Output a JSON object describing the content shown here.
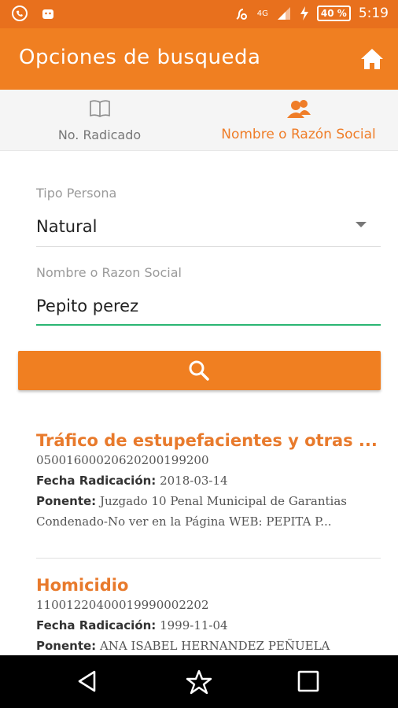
{
  "status_bar": {
    "network": "4G",
    "battery": "40 %",
    "time": "5:19"
  },
  "app_bar": {
    "title": "Opciones de busqueda"
  },
  "tabs": [
    {
      "label": "No. Radicado",
      "icon": "book-icon",
      "active": false
    },
    {
      "label": "Nombre o Razón Social",
      "icon": "people-icon",
      "active": true
    }
  ],
  "form": {
    "tipo_persona": {
      "label": "Tipo Persona",
      "value": "Natural"
    },
    "nombre": {
      "label": "Nombre o Razon Social",
      "value": "Pepito perez"
    }
  },
  "results": [
    {
      "title": "Tráfico de estupefacientes y otras ...",
      "number": "050016000206202001992​00",
      "fecha_label": "Fecha Radicación:",
      "fecha": "2018-03-14",
      "ponente_label": "Ponente:",
      "ponente": "Juzgado 10 Penal Municipal de Garantias",
      "extra": "Condenado-No ver en la Página WEB: PEPITA P..."
    },
    {
      "title": "Homicidio",
      "number": "110012204000199900022​02",
      "fecha_label": "Fecha Radicación:",
      "fecha": "1999-11-04",
      "ponente_label": "Ponente:",
      "ponente": "ANA ISABEL HERNANDEZ PEÑUELA"
    }
  ],
  "colors": {
    "accent": "#f07f21",
    "status": "#e8701d",
    "focus_line": "#2bb673"
  }
}
